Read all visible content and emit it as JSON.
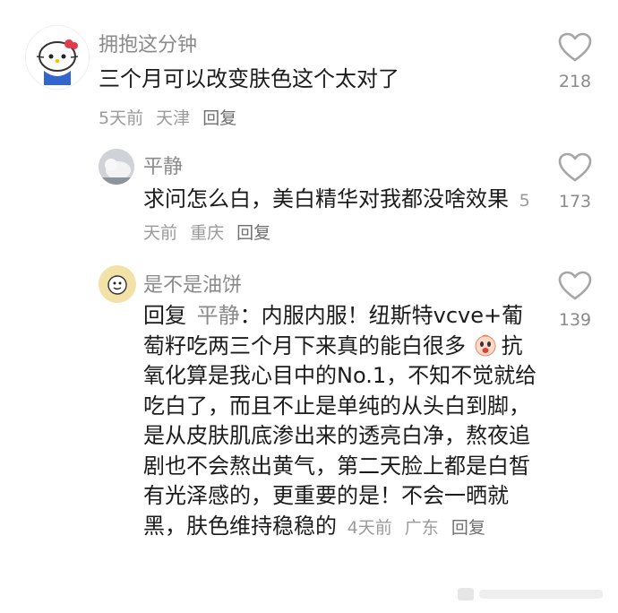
{
  "comments": [
    {
      "user": "拥抱这分钟",
      "text": "三个月可以改变肤色这个太对了",
      "time": "5天前",
      "location": "天津",
      "reply": "回复",
      "likes": "218"
    },
    {
      "user": "平静",
      "text": "求问怎么白，美白精华对我都没啥效果",
      "time": "5天前",
      "location": "重庆",
      "reply": "回复",
      "likes": "173"
    },
    {
      "user": "是不是油饼",
      "reply_prefix": "回复",
      "reply_to": "平静",
      "text_part1": "：内服内服！纽斯特vcve+葡萄籽吃两三个月下来真的能白很多",
      "text_part2": "抗氧化算是我心目中的No.1，不知不觉就给吃白了，而且不止是单纯的从头白到脚，是从皮肤肌底渗出来的透亮白净，熬夜追剧也不会熬出黄气，第二天脸上都是白皙有光泽感的，更重要的是！不会一晒就黑，肤色维持稳稳的",
      "time": "4天前",
      "location": "广东",
      "reply": "回复",
      "likes": "139"
    }
  ],
  "colors": {
    "secondary": "#8a8a8a",
    "text": "#1b1b1b",
    "icon": "#a6a6a6"
  },
  "icons": [
    "heart-outline-icon",
    "crying-emoji-icon",
    "hello-kitty-avatar",
    "cat-avatar",
    "emoji-avatar"
  ]
}
